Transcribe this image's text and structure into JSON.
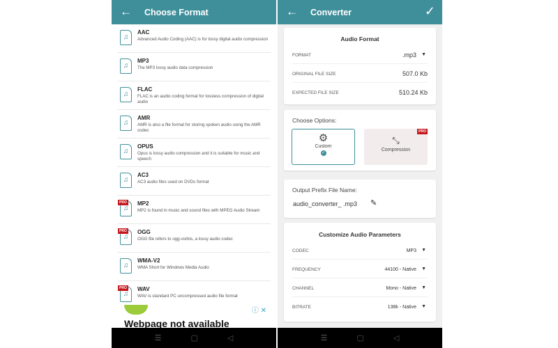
{
  "left": {
    "header": {
      "title": "Choose Format",
      "back_icon": "arrow-left-icon"
    },
    "formats": [
      {
        "name": "AAC",
        "desc": "Advanced Audio Coding (AAC) is for lossy digital audio compression",
        "pro": false
      },
      {
        "name": "MP3",
        "desc": "The MP3 lossy audio data compression",
        "pro": false
      },
      {
        "name": "FLAC",
        "desc": "FLAC is an audio coding format for lossless compression of digital audio",
        "pro": false
      },
      {
        "name": "AMR",
        "desc": "AMR is also a file format for storing spoken audio using the AMR codec",
        "pro": false
      },
      {
        "name": "OPUS",
        "desc": "Opus is lossy audio compression and it is suitable for music and speech",
        "pro": false
      },
      {
        "name": "AC3",
        "desc": "AC3 audio files used on DVDs format",
        "pro": false
      },
      {
        "name": "MP2",
        "desc": "MP2 is found in music and sound files with MPEG Audio Stream",
        "pro": true
      },
      {
        "name": "OGG",
        "desc": "OGG file refers to ogg-vorbis, a lossy audio codec",
        "pro": true
      },
      {
        "name": "WMA-V2",
        "desc": "WMA Short for Windows Media Audio",
        "pro": false
      },
      {
        "name": "WAV",
        "desc": "WAV is standard PC uncompressed audio file format",
        "pro": true
      }
    ],
    "pro_badge": "PRO",
    "ad": {
      "text": "Webpage not available"
    }
  },
  "right": {
    "header": {
      "title": "Converter"
    },
    "audio_format": {
      "title": "Audio Format",
      "format_label": "FORMAT",
      "format_value": ".mp3",
      "original_label": "ORIGINAL FILE SIZE",
      "original_value": "507.0 Kb",
      "expected_label": "EXPECTED FILE SIZE",
      "expected_value": "510.24 Kb"
    },
    "options": {
      "title": "Choose Options:",
      "custom": "Custom",
      "compression": "Compression",
      "pro_badge": "PRO",
      "selected": "Custom"
    },
    "prefix": {
      "title": "Output Prefix File Name:",
      "value": "audio_converter_ .mp3"
    },
    "params": {
      "title": "Customize Audio Parameters",
      "rows": [
        {
          "label": "CODEC",
          "value": "MP3"
        },
        {
          "label": "FREQUENCY",
          "value": "44100 - Native"
        },
        {
          "label": "CHANNEL",
          "value": "Mono - Native"
        },
        {
          "label": "BITRATE",
          "value": "138k - Native"
        }
      ]
    }
  },
  "colors": {
    "accent": "#3f8f9b",
    "pro": "#c4161c"
  }
}
